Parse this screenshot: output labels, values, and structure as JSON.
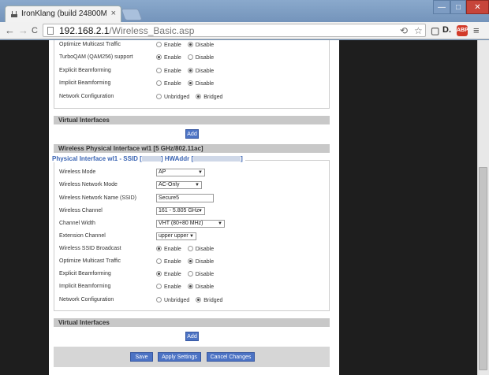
{
  "browser": {
    "tab_title": "IronKlang (build 24800M)",
    "tab_close": "×",
    "url_host": "192.168.2.1",
    "url_path": "/Wireless_Basic.asp",
    "back": "←",
    "forward": "→",
    "reload": "C",
    "ext_d": "D.",
    "abp": "ABP",
    "menu": "≡",
    "win_min": "—",
    "win_max": "□",
    "win_close": "✕"
  },
  "top_section": {
    "rows": [
      {
        "label": "Optimize Multicast Traffic",
        "opt1": "Enable",
        "opt2": "Disable",
        "selected": 2
      },
      {
        "label": "TurboQAM (QAM256) support",
        "opt1": "Enable",
        "opt2": "Disable",
        "selected": 1
      },
      {
        "label": "Explicit Beamforming",
        "opt1": "Enable",
        "opt2": "Disable",
        "selected": 2
      },
      {
        "label": "Implicit Beamforming",
        "opt1": "Enable",
        "opt2": "Disable",
        "selected": 2
      },
      {
        "label": "Network Configuration",
        "opt1": "Unbridged",
        "opt2": "Bridged",
        "selected": 2
      }
    ]
  },
  "virtual_interfaces_1": {
    "title": "Virtual Interfaces",
    "add": "Add"
  },
  "wl1_section": {
    "title": "Wireless Physical Interface wl1 [5 GHz/802.11ac]"
  },
  "ssid_legend": {
    "prefix": "Physical Interface wl1 - SSID [",
    "middle": "]  HWAddr [",
    "suffix": "]"
  },
  "ssid_fields": {
    "wireless_mode": {
      "label": "Wireless Mode",
      "value": "AP"
    },
    "network_mode": {
      "label": "Wireless Network Mode",
      "value": "AC-Only"
    },
    "ssid": {
      "label": "Wireless Network Name (SSID)",
      "value": "Secure5"
    },
    "channel": {
      "label": "Wireless Channel",
      "value": "161 - 5.805 GHz"
    },
    "channel_width": {
      "label": "Channel Width",
      "value": "VHT (80+80 MHz)"
    },
    "extension_channel": {
      "label": "Extension Channel",
      "value": "upper upper"
    },
    "radio_rows": [
      {
        "label": "Wireless SSID Broadcast",
        "opt1": "Enable",
        "opt2": "Disable",
        "selected": 1
      },
      {
        "label": "Optimize Multicast Traffic",
        "opt1": "Enable",
        "opt2": "Disable",
        "selected": 2
      },
      {
        "label": "Explicit Beamforming",
        "opt1": "Enable",
        "opt2": "Disable",
        "selected": 1
      },
      {
        "label": "Implicit Beamforming",
        "opt1": "Enable",
        "opt2": "Disable",
        "selected": 2
      },
      {
        "label": "Network Configuration",
        "opt1": "Unbridged",
        "opt2": "Bridged",
        "selected": 2
      }
    ]
  },
  "virtual_interfaces_2": {
    "title": "Virtual Interfaces",
    "add": "Add"
  },
  "footer": {
    "save": "Save",
    "apply": "Apply Settings",
    "cancel": "Cancel Changes"
  }
}
